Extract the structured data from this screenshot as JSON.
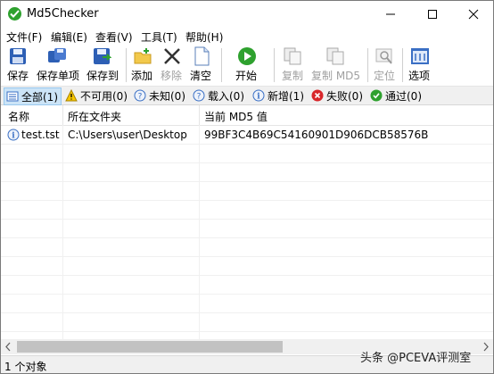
{
  "window": {
    "title": "Md5Checker"
  },
  "menu": [
    "文件(F)",
    "编辑(E)",
    "查看(V)",
    "工具(T)",
    "帮助(H)"
  ],
  "toolbar": {
    "save": "保存",
    "save_item": "保存单项",
    "save_to": "保存到",
    "add": "添加",
    "remove": "移除",
    "clear": "清空",
    "start": "开始",
    "copy": "复制",
    "copy_md5": "复制 MD5",
    "locate": "定位",
    "options": "选项"
  },
  "filters": [
    "全部(1)",
    "不可用(0)",
    "未知(0)",
    "载入(0)",
    "新增(1)",
    "失败(0)",
    "通过(0)"
  ],
  "table": {
    "columns": [
      "名称",
      "所在文件夹",
      "当前 MD5 值"
    ],
    "rows": [
      {
        "name": "test.tst",
        "folder": "C:\\Users\\user\\Desktop",
        "md5": "99BF3C4B69C54160901D906DCB58576B"
      }
    ]
  },
  "status": {
    "text": "1 个对象"
  },
  "watermark": "头条 @PCEVA评测室",
  "colors": {
    "accent": "#2ea12e",
    "selected_filter": "#cce4f7",
    "chrome": "#f0f0f0"
  }
}
